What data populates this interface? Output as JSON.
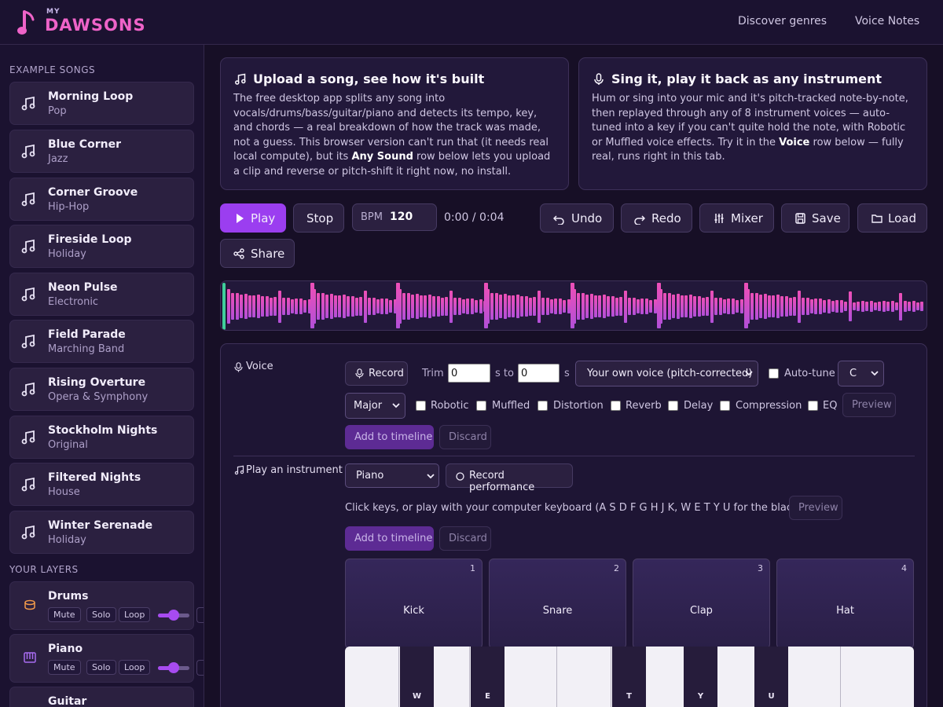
{
  "app": {
    "logo_top": "MY",
    "logo_main": "DAWSONS",
    "nav": [
      "Discover genres",
      "Voice Notes"
    ]
  },
  "sidebar": {
    "example_heading": "EXAMPLE SONGS",
    "songs": [
      {
        "title": "Morning Loop",
        "genre": "Pop"
      },
      {
        "title": "Blue Corner",
        "genre": "Jazz"
      },
      {
        "title": "Corner Groove",
        "genre": "Hip-Hop"
      },
      {
        "title": "Fireside Loop",
        "genre": "Holiday"
      },
      {
        "title": "Neon Pulse",
        "genre": "Electronic"
      },
      {
        "title": "Field Parade",
        "genre": "Marching Band"
      },
      {
        "title": "Rising Overture",
        "genre": "Opera & Symphony"
      },
      {
        "title": "Stockholm Nights",
        "genre": "Original"
      },
      {
        "title": "Filtered Nights",
        "genre": "House"
      },
      {
        "title": "Winter Serenade",
        "genre": "Holiday"
      }
    ],
    "layers_heading": "YOUR LAYERS",
    "layers": [
      {
        "name": "Drums",
        "icon": "drum-icon",
        "volume": 0.5
      },
      {
        "name": "Piano",
        "icon": "piano-icon",
        "volume": 0.5
      },
      {
        "name": "Guitar",
        "icon": "guitar-icon",
        "volume": 0.5
      }
    ],
    "layer_buttons": {
      "mute": "Mute",
      "solo": "Solo",
      "loop": "Loop"
    }
  },
  "cards": {
    "upload": {
      "title": "Upload a song, see how it's built",
      "body_1": "The free desktop app splits any song into vocals/drums/bass/guitar/piano and detects its tempo, key, and chords — a real breakdown of how the track was made, not a guess. This browser version can't run that (it needs real local compute), but its ",
      "body_bold": "Any Sound",
      "body_2": " row below lets you upload a clip and reverse or pitch-shift it right now, no install."
    },
    "sing": {
      "title": "Sing it, play it back as any instrument",
      "body_1": "Hum or sing into your mic and it's pitch-tracked note-by-note, then replayed through any of 8 instrument voices — auto-tuned into a key if you can't quite hold the note, with Robotic or Muffled voice effects. Try it in the ",
      "body_bold": "Voice",
      "body_2": " row below — fully real, runs right in this tab."
    }
  },
  "transport": {
    "play": "Play",
    "stop": "Stop",
    "bpm_label": "BPM",
    "bpm_value": "120",
    "time": "0:00 / 0:04",
    "undo": "Undo",
    "redo": "Redo",
    "mixer": "Mixer",
    "save": "Save",
    "load": "Load",
    "share": "Share"
  },
  "voice": {
    "label": "Voice",
    "record": "Record",
    "trim_label": "Trim",
    "trim_start": "0",
    "trim_mid": "s to",
    "trim_end": "0",
    "trim_unit": "s",
    "voice_select": "Your own voice (pitch-corrected)",
    "autotune": "Auto-tune",
    "key_select": "C",
    "scale_select": "Major",
    "effects": [
      "Robotic",
      "Muffled",
      "Distortion",
      "Reverb",
      "Delay",
      "Compression",
      "EQ"
    ],
    "preview": "Preview",
    "add": "Add to timeline",
    "discard": "Discard"
  },
  "instrument": {
    "label": "Play an instrument",
    "select": "Piano",
    "record_perf": "Record performance",
    "hint": "Click keys, or play with your computer keyboard (A S D F G H J K, W E T Y U for the black keys).",
    "preview": "Preview",
    "add": "Add to timeline",
    "discard": "Discard",
    "pads": [
      {
        "name": "Kick",
        "num": "1"
      },
      {
        "name": "Snare",
        "num": "2"
      },
      {
        "name": "Clap",
        "num": "3"
      },
      {
        "name": "Hat",
        "num": "4"
      }
    ],
    "black_keys": [
      "W",
      "E",
      "T",
      "Y",
      "U"
    ]
  },
  "colors": {
    "accent": "#9b3ef0",
    "logo_pink": "#ee63c8",
    "waveform_top": "#ee4fb7",
    "waveform_bottom": "#b24fd8"
  }
}
